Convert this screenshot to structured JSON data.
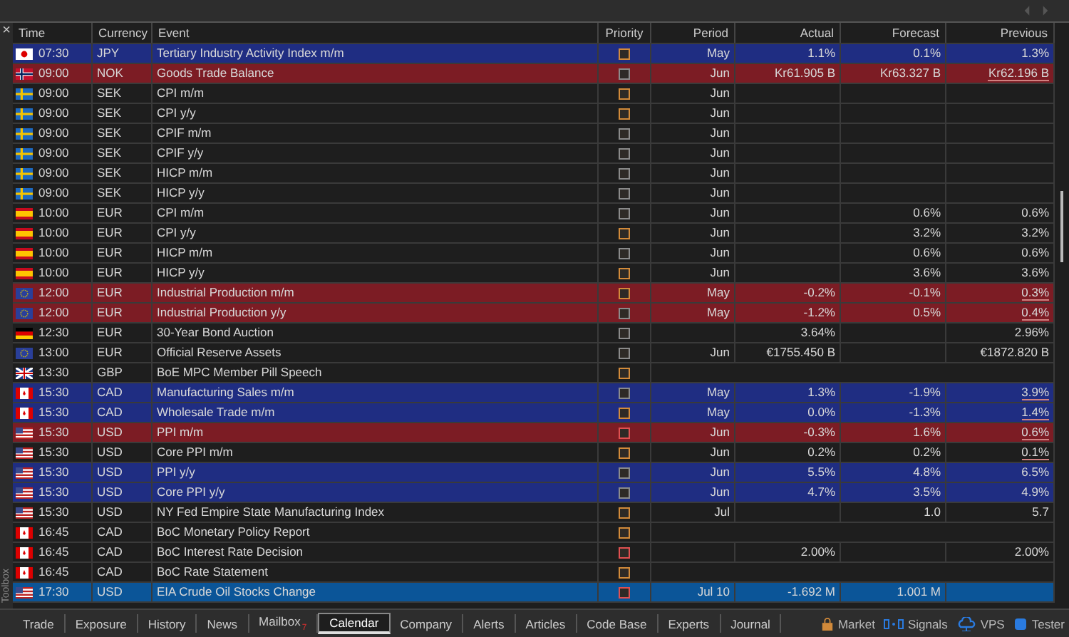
{
  "close_label": "×",
  "toolbox_label": "Toolbox",
  "columns": [
    "Time",
    "Currency",
    "Event",
    "Priority",
    "Period",
    "Actual",
    "Forecast",
    "Previous"
  ],
  "rows": [
    {
      "kind": "release",
      "flag": {
        "kind": "jp"
      },
      "time": "07:30",
      "currency": "JPY",
      "event": "Tertiary Industry Activity Index m/m",
      "priority": {
        "color": "#d28a3a"
      },
      "period": "May",
      "actual": "1.1%",
      "forecast": "0.1%",
      "previous": "1.3%",
      "revised": false,
      "color": "#1f2d82",
      "selected": false
    },
    {
      "kind": "release",
      "flag": {
        "kind": "no"
      },
      "time": "09:00",
      "currency": "NOK",
      "event": "Goods Trade Balance",
      "priority": {
        "color": "#8a8a8a"
      },
      "period": "Jun",
      "actual": "Kr61.905 B",
      "forecast": "Kr63.327 B",
      "previous": "Kr62.196 B",
      "revised": true,
      "color": "#7c1c24",
      "selected": false
    },
    {
      "kind": "release",
      "flag": {
        "kind": "se"
      },
      "time": "09:00",
      "currency": "SEK",
      "event": "CPI m/m",
      "priority": {
        "color": "#d28a3a"
      },
      "period": "Jun",
      "selected": false
    },
    {
      "kind": "release",
      "flag": {
        "kind": "se"
      },
      "time": "09:00",
      "currency": "SEK",
      "event": "CPI y/y",
      "priority": {
        "color": "#d28a3a"
      },
      "period": "Jun",
      "selected": false
    },
    {
      "kind": "release",
      "flag": {
        "kind": "se"
      },
      "time": "09:00",
      "currency": "SEK",
      "event": "CPIF m/m",
      "priority": {
        "color": "#8a8a8a"
      },
      "period": "Jun",
      "selected": false
    },
    {
      "kind": "release",
      "flag": {
        "kind": "se"
      },
      "time": "09:00",
      "currency": "SEK",
      "event": "CPIF y/y",
      "priority": {
        "color": "#8a8a8a"
      },
      "period": "Jun",
      "selected": false
    },
    {
      "kind": "release",
      "flag": {
        "kind": "se"
      },
      "time": "09:00",
      "currency": "SEK",
      "event": "HICP m/m",
      "priority": {
        "color": "#8a8a8a"
      },
      "period": "Jun",
      "selected": false
    },
    {
      "kind": "release",
      "flag": {
        "kind": "se"
      },
      "time": "09:00",
      "currency": "SEK",
      "event": "HICP y/y",
      "priority": {
        "color": "#8a8a8a"
      },
      "period": "Jun",
      "selected": false
    },
    {
      "kind": "release",
      "flag": {
        "kind": "es"
      },
      "time": "10:00",
      "currency": "EUR",
      "event": "CPI m/m",
      "priority": {
        "color": "#8a8a8a"
      },
      "period": "Jun",
      "forecast": "0.6%",
      "previous": "0.6%",
      "revised": false,
      "selected": false
    },
    {
      "kind": "release",
      "flag": {
        "kind": "es"
      },
      "time": "10:00",
      "currency": "EUR",
      "event": "CPI y/y",
      "priority": {
        "color": "#d28a3a"
      },
      "period": "Jun",
      "forecast": "3.2%",
      "previous": "3.2%",
      "revised": false,
      "selected": false
    },
    {
      "kind": "release",
      "flag": {
        "kind": "es"
      },
      "time": "10:00",
      "currency": "EUR",
      "event": "HICP m/m",
      "priority": {
        "color": "#8a8a8a"
      },
      "period": "Jun",
      "forecast": "0.6%",
      "previous": "0.6%",
      "revised": false,
      "selected": false
    },
    {
      "kind": "release",
      "flag": {
        "kind": "es"
      },
      "time": "10:00",
      "currency": "EUR",
      "event": "HICP y/y",
      "priority": {
        "color": "#d28a3a"
      },
      "period": "Jun",
      "forecast": "3.6%",
      "previous": "3.6%",
      "revised": false,
      "selected": false
    },
    {
      "kind": "release",
      "flag": {
        "kind": "eu"
      },
      "time": "12:00",
      "currency": "EUR",
      "event": "Industrial Production m/m",
      "priority": {
        "color": "#d28a3a"
      },
      "period": "May",
      "actual": "-0.2%",
      "forecast": "-0.1%",
      "previous": "0.3%",
      "revised": true,
      "color": "#7c1c24",
      "selected": false
    },
    {
      "kind": "release",
      "flag": {
        "kind": "eu"
      },
      "time": "12:00",
      "currency": "EUR",
      "event": "Industrial Production y/y",
      "priority": {
        "color": "#8a8a8a"
      },
      "period": "May",
      "actual": "-1.2%",
      "forecast": "0.5%",
      "previous": "0.4%",
      "revised": true,
      "color": "#7c1c24",
      "selected": false
    },
    {
      "kind": "release",
      "flag": {
        "kind": "de"
      },
      "time": "12:30",
      "currency": "EUR",
      "event": "30-Year Bond Auction",
      "priority": {
        "color": "#8a8a8a"
      },
      "actual": "3.64%",
      "previous": "2.96%",
      "revised": false,
      "selected": false
    },
    {
      "kind": "release",
      "flag": {
        "kind": "eu"
      },
      "time": "13:00",
      "currency": "EUR",
      "event": "Official Reserve Assets",
      "priority": {
        "color": "#8a8a8a"
      },
      "period": "Jun",
      "actual": "€1755.450 B",
      "previous": "€1872.820 B",
      "revised": false,
      "selected": false
    },
    {
      "kind": "speech",
      "flag": {
        "kind": "gb"
      },
      "time": "13:30",
      "currency": "GBP",
      "event": "BoE MPC Member Pill Speech",
      "priority": {
        "color": "#d28a3a"
      },
      "selected": false
    },
    {
      "kind": "release",
      "flag": {
        "kind": "ca"
      },
      "time": "15:30",
      "currency": "CAD",
      "event": "Manufacturing Sales m/m",
      "priority": {
        "color": "#8a8a8a"
      },
      "period": "May",
      "actual": "1.3%",
      "forecast": "-1.9%",
      "previous": "3.9%",
      "revised": true,
      "color": "#1f2d82",
      "selected": false
    },
    {
      "kind": "release",
      "flag": {
        "kind": "ca"
      },
      "time": "15:30",
      "currency": "CAD",
      "event": "Wholesale Trade m/m",
      "priority": {
        "color": "#d28a3a"
      },
      "period": "May",
      "actual": "0.0%",
      "forecast": "-1.3%",
      "previous": "1.4%",
      "revised": true,
      "color": "#1f2d82",
      "selected": false
    },
    {
      "kind": "release",
      "flag": {
        "kind": "us"
      },
      "time": "15:30",
      "currency": "USD",
      "event": "PPI m/m",
      "priority": {
        "color": "#e05050"
      },
      "period": "Jun",
      "actual": "-0.3%",
      "forecast": "1.6%",
      "previous": "0.6%",
      "revised": true,
      "color": "#7c1c24",
      "selected": false
    },
    {
      "kind": "release",
      "flag": {
        "kind": "us"
      },
      "time": "15:30",
      "currency": "USD",
      "event": "Core PPI m/m",
      "priority": {
        "color": "#d28a3a"
      },
      "period": "Jun",
      "actual": "0.2%",
      "forecast": "0.2%",
      "previous": "0.1%",
      "revised": true,
      "selected": false
    },
    {
      "kind": "release",
      "flag": {
        "kind": "us"
      },
      "time": "15:30",
      "currency": "USD",
      "event": "PPI y/y",
      "priority": {
        "color": "#8a8a8a"
      },
      "period": "Jun",
      "actual": "5.5%",
      "forecast": "4.8%",
      "previous": "6.5%",
      "revised": false,
      "color": "#1f2d82",
      "selected": false
    },
    {
      "kind": "release",
      "flag": {
        "kind": "us"
      },
      "time": "15:30",
      "currency": "USD",
      "event": "Core PPI y/y",
      "priority": {
        "color": "#8a8a8a"
      },
      "period": "Jun",
      "actual": "4.7%",
      "forecast": "3.5%",
      "previous": "4.9%",
      "revised": false,
      "color": "#1f2d82",
      "selected": false
    },
    {
      "kind": "release",
      "flag": {
        "kind": "us"
      },
      "time": "15:30",
      "currency": "USD",
      "event": "NY Fed Empire State Manufacturing Index",
      "priority": {
        "color": "#d28a3a"
      },
      "period": "Jul",
      "forecast": "1.0",
      "previous": "5.7",
      "revised": false,
      "selected": false
    },
    {
      "kind": "speech",
      "flag": {
        "kind": "ca"
      },
      "time": "16:45",
      "currency": "CAD",
      "event": "BoC Monetary Policy Report",
      "priority": {
        "color": "#d28a3a"
      },
      "selected": false
    },
    {
      "kind": "release",
      "flag": {
        "kind": "ca"
      },
      "time": "16:45",
      "currency": "CAD",
      "event": "BoC Interest Rate Decision",
      "priority": {
        "color": "#e05050"
      },
      "actual": "2.00%",
      "previous": "2.00%",
      "revised": false,
      "selected": false
    },
    {
      "kind": "speech",
      "flag": {
        "kind": "ca"
      },
      "time": "16:45",
      "currency": "CAD",
      "event": "BoC Rate Statement",
      "priority": {
        "color": "#d28a3a"
      },
      "selected": false
    },
    {
      "kind": "release",
      "flag": {
        "kind": "us"
      },
      "time": "17:30",
      "currency": "USD",
      "event": "EIA Crude Oil Stocks Change",
      "priority": {
        "color": "#e05050"
      },
      "period": "Jul 10",
      "actual": "-1.692 M",
      "forecast": "1.001 M",
      "selected": true
    }
  ],
  "tabs": [
    {
      "label": "Trade",
      "selected": false
    },
    {
      "label": "Exposure",
      "selected": false
    },
    {
      "label": "History",
      "selected": false
    },
    {
      "label": "News",
      "selected": false
    },
    {
      "label": "Mailbox",
      "badge": "7",
      "selected": false
    },
    {
      "label": "Calendar",
      "selected": true
    },
    {
      "label": "Company",
      "selected": false
    },
    {
      "label": "Alerts",
      "selected": false
    },
    {
      "label": "Articles",
      "selected": false
    },
    {
      "label": "Code Base",
      "selected": false
    },
    {
      "label": "Experts",
      "selected": false
    },
    {
      "label": "Journal",
      "selected": false
    }
  ],
  "services": [
    {
      "kind": "market",
      "label": "Market"
    },
    {
      "kind": "signals",
      "label": "Signals"
    },
    {
      "kind": "vps",
      "label": "VPS"
    },
    {
      "kind": "tester",
      "label": "Tester"
    }
  ]
}
